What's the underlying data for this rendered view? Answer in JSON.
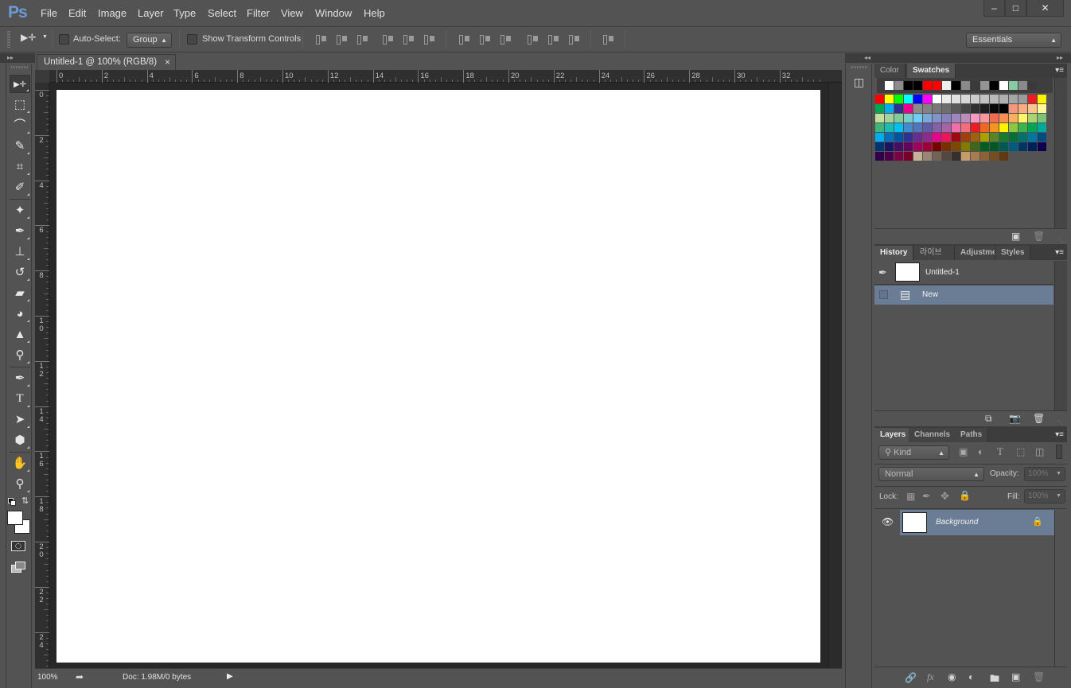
{
  "app": {
    "logo": "Ps"
  },
  "menu": [
    "File",
    "Edit",
    "Image",
    "Layer",
    "Type",
    "Select",
    "Filter",
    "View",
    "Window",
    "Help"
  ],
  "window_controls": {
    "minimize": "–",
    "maximize": "□",
    "close": "✕"
  },
  "options": {
    "tool_icon": "move-tool-icon",
    "auto_select_label": "Auto-Select:",
    "auto_select_checked": false,
    "auto_select_mode": "Group",
    "show_transform_label": "Show Transform Controls",
    "show_transform_checked": false,
    "align_icons": [
      "align-top-edges-icon",
      "align-vertical-centers-icon",
      "align-bottom-edges-icon",
      "align-left-edges-icon",
      "align-horizontal-centers-icon",
      "align-right-edges-icon",
      "distribute-top-edges-icon",
      "distribute-vertical-centers-icon",
      "distribute-bottom-edges-icon",
      "distribute-left-edges-icon",
      "distribute-horizontal-centers-icon",
      "distribute-right-edges-icon",
      "auto-align-layers-icon"
    ],
    "workspace": "Essentials"
  },
  "document": {
    "tab_title": "Untitled-1 @ 100% (RGB/8)",
    "tab_close": "×",
    "ruler_top": [
      "0",
      "2",
      "4",
      "6",
      "8",
      "10",
      "12",
      "14",
      "16",
      "18",
      "20",
      "22",
      "24",
      "26",
      "28",
      "30",
      "32"
    ],
    "ruler_left": [
      "0",
      "2",
      "4",
      "6",
      "8",
      "10",
      "12",
      "14",
      "16",
      "18",
      "20",
      "22",
      "24"
    ],
    "zoom": "100%",
    "doc_info": "Doc: 1.98M/0 bytes",
    "status_menu_arrow": "▶"
  },
  "tools": [
    {
      "name": "move-tool",
      "glyph": "▶✛",
      "active": true
    },
    {
      "name": "rectangular-marquee-tool",
      "glyph": "⬚"
    },
    {
      "name": "lasso-tool",
      "glyph": "⌒"
    },
    {
      "name": "quick-selection-tool",
      "glyph": "✎"
    },
    {
      "name": "crop-tool",
      "glyph": "⌗"
    },
    {
      "name": "eyedropper-tool",
      "glyph": "✐"
    },
    {
      "name": "healing-brush-tool",
      "glyph": "✦"
    },
    {
      "name": "brush-tool",
      "glyph": "✒"
    },
    {
      "name": "clone-stamp-tool",
      "glyph": "⊥"
    },
    {
      "name": "history-brush-tool",
      "glyph": "↺"
    },
    {
      "name": "eraser-tool",
      "glyph": "▰"
    },
    {
      "name": "paint-bucket-tool",
      "glyph": "◕"
    },
    {
      "name": "blur-tool",
      "glyph": "▲"
    },
    {
      "name": "dodge-tool",
      "glyph": "⚲"
    },
    {
      "name": "pen-tool",
      "glyph": "✒"
    },
    {
      "name": "type-tool",
      "glyph": "T"
    },
    {
      "name": "path-selection-tool",
      "glyph": "➤"
    },
    {
      "name": "shape-tool",
      "glyph": "⬢"
    },
    {
      "name": "hand-tool",
      "glyph": "✋"
    },
    {
      "name": "zoom-tool",
      "glyph": "⚲"
    }
  ],
  "colors": {
    "foreground": "#ffffff",
    "background": "#ffffff",
    "accent_selection": "#6a7d95",
    "panel_bg": "#535353",
    "dark_bg": "#282828"
  },
  "swatches_panel": {
    "tabs": [
      "Color",
      "Swatches"
    ],
    "active_tab": "Swatches",
    "recent": [
      "#ffffff",
      "#8c8c8c",
      "#000000",
      "#000000",
      "#ff0000",
      "#ff0000",
      "#eeeeee",
      "#000000",
      "#8a8a8a",
      "#3a3a3a",
      "#949494",
      "#000000",
      "#ffffff",
      "#86cba3",
      "#8a8a8a",
      "#3a3a3a"
    ],
    "rows": [
      [
        "#ff0000",
        "#ffff00",
        "#00ff00",
        "#00ffff",
        "#0000ff",
        "#ff00ff",
        "#ffffff",
        "#ebebeb",
        "#e1e1e1",
        "#d7d7d7",
        "#cdcdcd",
        "#c3c3c3",
        "#b9b9b9",
        "#afafaf",
        "#a5a5a5",
        "#9b9b9b",
        "#ed1c24",
        "#fff200"
      ],
      [
        "#00a651",
        "#00aeef",
        "#2e3192",
        "#ec008c",
        "#8c8c8c",
        "#828282",
        "#787878",
        "#6e6e6e",
        "#5a5a5a",
        "#464646",
        "#323232",
        "#1e1e1e",
        "#0a0a0a",
        "#000000",
        "#f7977a",
        "#fbad82",
        "#fdc68a",
        "#fff79a"
      ],
      [
        "#c4df9b",
        "#a3d39c",
        "#82ca9c",
        "#7accc8",
        "#6dcff6",
        "#7da7d9",
        "#8393ca",
        "#8781bd",
        "#a186be",
        "#bd8cbf",
        "#f49ac2",
        "#f6989d",
        "#f26c4f",
        "#f68e55",
        "#fbaf5c",
        "#fff568",
        "#acd372",
        "#7cc576"
      ],
      [
        "#3bb878",
        "#1abbb4",
        "#00bff3",
        "#438ccb",
        "#5574b9",
        "#605ca8",
        "#855fa8",
        "#a763a8",
        "#f06ea9",
        "#f26d7d",
        "#ed1c24",
        "#f26522",
        "#f7941d",
        "#fff200",
        "#8dc63f",
        "#39b54a",
        "#00a651",
        "#00a99d"
      ],
      [
        "#00aeef",
        "#0072bc",
        "#0054a6",
        "#2e3192",
        "#662d91",
        "#92278f",
        "#ec008c",
        "#ed145b",
        "#9e0b0f",
        "#a0410d",
        "#a36209",
        "#aba000",
        "#598527",
        "#197b30",
        "#007236",
        "#00746b",
        "#0076a3",
        "#004b80"
      ],
      [
        "#003471",
        "#1b1464",
        "#440e62",
        "#630460",
        "#9e005d",
        "#9e0039",
        "#790000",
        "#7b2e00",
        "#7d4900",
        "#827b00",
        "#406618",
        "#005e20",
        "#005826",
        "#005952",
        "#005b7f",
        "#003663",
        "#002157",
        "#0d004c"
      ],
      [
        "#32004b",
        "#4b0049",
        "#7b0046",
        "#7a0026",
        "#c7b299",
        "#998675",
        "#736357",
        "#534741",
        "#362f2d",
        "#c69c6d",
        "#a67c52",
        "#8c6239",
        "#754c24",
        "#603913"
      ]
    ]
  },
  "history_panel": {
    "tabs": [
      "History",
      "라이브러리",
      "Adjustme",
      "Styles"
    ],
    "active_tab": "History",
    "snapshot": "Untitled-1",
    "states": [
      {
        "label": "New",
        "selected": true
      }
    ]
  },
  "layers_panel": {
    "tabs": [
      "Layers",
      "Channels",
      "Paths"
    ],
    "active_tab": "Layers",
    "filter_kind": "Kind",
    "blend_mode": "Normal",
    "opacity_label": "Opacity:",
    "opacity": "100%",
    "lock_label": "Lock:",
    "fill_label": "Fill:",
    "fill": "100%",
    "layers": [
      {
        "name": "Background",
        "visible": true,
        "locked": true,
        "selected": true
      }
    ]
  }
}
